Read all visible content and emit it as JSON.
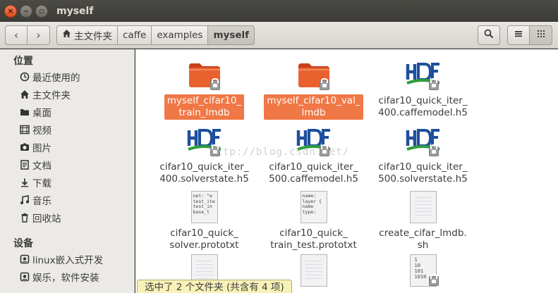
{
  "window": {
    "title": "myself",
    "close_glyph": "×",
    "min_glyph": "–",
    "max_glyph": "▫"
  },
  "toolbar": {
    "back_glyph": "‹",
    "forward_glyph": "›",
    "breadcrumbs": [
      "主文件夹",
      "caffe",
      "examples",
      "myself"
    ],
    "search_icon": "search-icon",
    "list_icon": "list-view-icon",
    "grid_icon": "grid-view-icon"
  },
  "sidebar": {
    "places_header": "位置",
    "places": [
      {
        "label": "最近使用的",
        "icon": "recent-icon"
      },
      {
        "label": "主文件夹",
        "icon": "home-icon"
      },
      {
        "label": "桌面",
        "icon": "desktop-icon"
      },
      {
        "label": "视频",
        "icon": "video-icon"
      },
      {
        "label": "图片",
        "icon": "picture-icon"
      },
      {
        "label": "文档",
        "icon": "document-icon"
      },
      {
        "label": "下载",
        "icon": "download-icon"
      },
      {
        "label": "音乐",
        "icon": "music-icon"
      },
      {
        "label": "回收站",
        "icon": "trash-icon"
      }
    ],
    "devices_header": "设备",
    "devices": [
      {
        "label": "linux嵌入式开发",
        "icon": "drive-icon"
      },
      {
        "label": "娱乐，软件安装",
        "icon": "drive-icon"
      }
    ]
  },
  "files": [
    {
      "name": "myself_cifar10_train_lmdb",
      "line1": "myself_cifar10_",
      "line2": "train_lmdb",
      "type": "folder",
      "selected": true
    },
    {
      "name": "myself_cifar10_val_lmdb",
      "line1": "myself_cifar10_val_",
      "line2": "lmdb",
      "type": "folder",
      "selected": true
    },
    {
      "name": "cifar10_quick_iter_400.caffemodel.h5",
      "line1": "cifar10_quick_iter_",
      "line2": "400.caffemodel.h5",
      "type": "h5",
      "selected": false
    },
    {
      "name": "cifar10_quick_iter_400.solverstate.h5",
      "line1": "cifar10_quick_iter_",
      "line2": "400.solverstate.h5",
      "type": "h5",
      "selected": false
    },
    {
      "name": "cifar10_quick_iter_500.caffemodel.h5",
      "line1": "cifar10_quick_iter_",
      "line2": "500.caffemodel.h5",
      "type": "h5",
      "selected": false
    },
    {
      "name": "cifar10_quick_iter_500.solverstate.h5",
      "line1": "cifar10_quick_iter_",
      "line2": "500.solverstate.h5",
      "type": "h5",
      "selected": false
    },
    {
      "name": "cifar10_quick_solver.prototxt",
      "line1": "cifar10_quick_",
      "line2": "solver.prototxt",
      "type": "text",
      "preview": [
        "net: \"e",
        "test_ite",
        "test_in",
        "base_l"
      ],
      "selected": false
    },
    {
      "name": "cifar10_quick_train_test.prototxt",
      "line1": "cifar10_quick_",
      "line2": "train_test.prototxt",
      "type": "text",
      "preview": [
        "name:",
        "layer {",
        " name",
        " type:"
      ],
      "selected": false
    },
    {
      "name": "create_cifar_lmdb.sh",
      "line1": "create_cifar_lmdb.",
      "line2": "sh",
      "type": "script",
      "selected": false
    },
    {
      "name": "",
      "line1": "",
      "line2": "",
      "type": "script",
      "selected": false
    },
    {
      "name": "",
      "line1": "",
      "line2": "",
      "type": "script",
      "selected": false
    },
    {
      "name": "",
      "line1": "",
      "line2": "",
      "type": "binary",
      "preview": [
        "1",
        "10",
        "101",
        "1010"
      ],
      "selected": false
    }
  ],
  "status": "选中了 2 个文件夹 (共含有 4 项)",
  "watermark": "http://blog.csdn.net/",
  "colors": {
    "selection": "#f07746",
    "folder": "#e0542a",
    "h5_blue": "#1f4f9e",
    "h5_green": "#2e9d3a"
  }
}
